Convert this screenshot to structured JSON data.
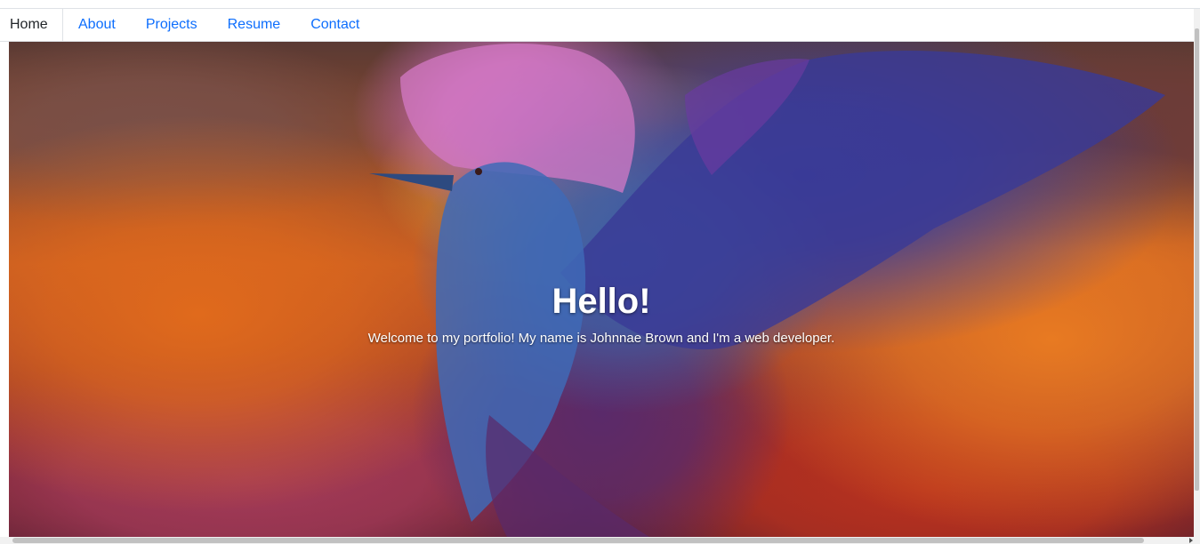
{
  "nav": {
    "items": [
      {
        "label": "Home",
        "active": true
      },
      {
        "label": "About",
        "active": false
      },
      {
        "label": "Projects",
        "active": false
      },
      {
        "label": "Resume",
        "active": false
      },
      {
        "label": "Contact",
        "active": false
      }
    ]
  },
  "hero": {
    "title": "Hello!",
    "subtitle": "Welcome to my portfolio! My name is Johnnae Brown and I'm a web developer.",
    "background_image": "phoenix-bird-illustration"
  },
  "colors": {
    "link": "#0d6efd",
    "active_text": "#212529",
    "hero_text": "#ffffff"
  }
}
